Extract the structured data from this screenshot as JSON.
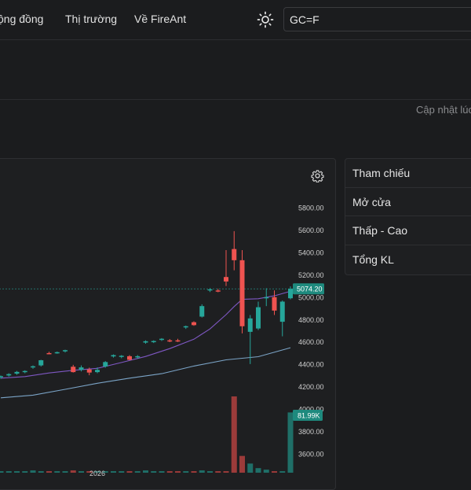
{
  "nav": {
    "community": "ộng đồng",
    "market": "Thị trường",
    "about": "Về FireAnt"
  },
  "search": {
    "value": "GC=F"
  },
  "status": {
    "updated_label": "Cập nhật lúc"
  },
  "info": {
    "rows": [
      {
        "label": "Tham chiếu"
      },
      {
        "label": "Mở cửa"
      },
      {
        "label": "Thấp - Cao"
      },
      {
        "label": "Tổng KL"
      }
    ]
  },
  "colors": {
    "up": "#26a69a",
    "down": "#ef5350",
    "ma_short": "#7e57c2",
    "ma_long": "#7ba4c7"
  },
  "chart_data": {
    "type": "candlestick",
    "price_axis": {
      "ticks": [
        "5800.00",
        "5600.00",
        "5400.00",
        "5200.00",
        "5000.00",
        "4800.00",
        "4600.00",
        "4400.00",
        "4200.00",
        "4000.00",
        "3800.00",
        "3600.00"
      ],
      "ylim": [
        3500,
        5900
      ]
    },
    "last_price_label": "5074.20",
    "last_price": 5074.2,
    "volume_label": "81.99K",
    "x_label_partial": "2026",
    "candles": [
      {
        "o": 4284,
        "h": 4300,
        "l": 4270,
        "c": 4294
      },
      {
        "o": 4300,
        "h": 4320,
        "l": 4290,
        "c": 4312
      },
      {
        "o": 4316,
        "h": 4340,
        "l": 4306,
        "c": 4332
      },
      {
        "o": 4334,
        "h": 4346,
        "l": 4320,
        "c": 4340
      },
      {
        "o": 4372,
        "h": 4390,
        "l": 4360,
        "c": 4382
      },
      {
        "o": 4390,
        "h": 4440,
        "l": 4380,
        "c": 4436
      },
      {
        "o": 4500,
        "h": 4512,
        "l": 4490,
        "c": 4496
      },
      {
        "o": 4502,
        "h": 4514,
        "l": 4494,
        "c": 4508
      },
      {
        "o": 4520,
        "h": 4530,
        "l": 4506,
        "c": 4526
      },
      {
        "o": 4378,
        "h": 4395,
        "l": 4326,
        "c": 4330
      },
      {
        "o": 4350,
        "h": 4390,
        "l": 4336,
        "c": 4372
      },
      {
        "o": 4354,
        "h": 4370,
        "l": 4302,
        "c": 4326
      },
      {
        "o": 4330,
        "h": 4372,
        "l": 4320,
        "c": 4350
      },
      {
        "o": 4380,
        "h": 4428,
        "l": 4370,
        "c": 4420
      },
      {
        "o": 4470,
        "h": 4488,
        "l": 4460,
        "c": 4482
      },
      {
        "o": 4470,
        "h": 4482,
        "l": 4454,
        "c": 4476
      },
      {
        "o": 4472,
        "h": 4482,
        "l": 4436,
        "c": 4440
      },
      {
        "o": 4464,
        "h": 4482,
        "l": 4452,
        "c": 4472
      },
      {
        "o": 4594,
        "h": 4614,
        "l": 4584,
        "c": 4606
      },
      {
        "o": 4602,
        "h": 4614,
        "l": 4590,
        "c": 4608
      },
      {
        "o": 4622,
        "h": 4634,
        "l": 4608,
        "c": 4628
      },
      {
        "o": 4614,
        "h": 4626,
        "l": 4598,
        "c": 4606
      },
      {
        "o": 4614,
        "h": 4628,
        "l": 4600,
        "c": 4610
      },
      {
        "o": 4732,
        "h": 4746,
        "l": 4716,
        "c": 4740
      },
      {
        "o": 4776,
        "h": 4784,
        "l": 4744,
        "c": 4750
      },
      {
        "o": 4826,
        "h": 4936,
        "l": 4818,
        "c": 4920
      },
      {
        "o": 5060,
        "h": 5080,
        "l": 5046,
        "c": 5070
      },
      {
        "o": 5060,
        "h": 5074,
        "l": 5044,
        "c": 5056
      },
      {
        "o": 5180,
        "h": 5420,
        "l": 5100,
        "c": 5140
      },
      {
        "o": 5430,
        "h": 5590,
        "l": 5240,
        "c": 5330
      },
      {
        "o": 5330,
        "h": 5420,
        "l": 4676,
        "c": 4740
      },
      {
        "o": 4690,
        "h": 4840,
        "l": 4402,
        "c": 4810
      },
      {
        "o": 4720,
        "h": 4960,
        "l": 4706,
        "c": 4910
      },
      {
        "o": 4990,
        "h": 5080,
        "l": 4920,
        "c": 5000
      },
      {
        "o": 5000,
        "h": 5060,
        "l": 4840,
        "c": 4880
      },
      {
        "o": 4780,
        "h": 4970,
        "l": 4650,
        "c": 4960
      },
      {
        "o": 4990,
        "h": 5096,
        "l": 4980,
        "c": 5074.2
      }
    ],
    "ma_short": [
      [
        0,
        4276
      ],
      [
        3,
        4290
      ],
      [
        6,
        4322
      ],
      [
        9,
        4346
      ],
      [
        12,
        4364
      ],
      [
        15,
        4416
      ],
      [
        18,
        4470
      ],
      [
        21,
        4540
      ],
      [
        24,
        4624
      ],
      [
        26,
        4716
      ],
      [
        28,
        4844
      ],
      [
        29,
        4916
      ],
      [
        30,
        4980
      ],
      [
        32,
        4986
      ],
      [
        34,
        5012
      ],
      [
        36,
        5052
      ]
    ],
    "ma_long": [
      [
        0,
        4100
      ],
      [
        4,
        4124
      ],
      [
        8,
        4176
      ],
      [
        12,
        4230
      ],
      [
        16,
        4276
      ],
      [
        20,
        4316
      ],
      [
        24,
        4384
      ],
      [
        28,
        4440
      ],
      [
        32,
        4468
      ],
      [
        36,
        4548
      ]
    ],
    "volume": [
      0.02,
      0.02,
      0.02,
      0.02,
      0.03,
      0.02,
      0.02,
      0.02,
      0.02,
      0.03,
      0.02,
      0.02,
      0.02,
      0.02,
      0.02,
      0.02,
      0.02,
      0.02,
      0.03,
      0.02,
      0.02,
      0.02,
      0.02,
      0.02,
      0.02,
      0.03,
      0.02,
      0.02,
      0.02,
      1.0,
      0.22,
      0.12,
      0.06,
      0.04,
      0.02,
      0.02,
      0.79
    ]
  }
}
